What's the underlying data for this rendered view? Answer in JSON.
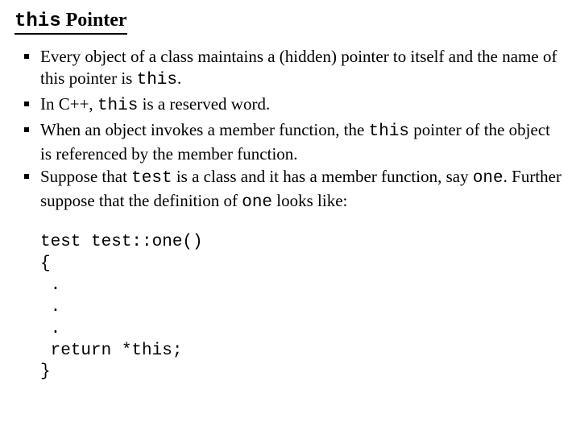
{
  "title": {
    "code": "this",
    "rest": " Pointer"
  },
  "bullets": [
    {
      "parts": [
        {
          "t": "Every object of a class maintains a (hidden) pointer to itself and the name of this pointer is "
        },
        {
          "t": "this",
          "mono": true
        },
        {
          "t": "."
        }
      ]
    },
    {
      "parts": [
        {
          "t": "In C++, "
        },
        {
          "t": "this",
          "mono": true
        },
        {
          "t": " is a reserved word."
        }
      ]
    },
    {
      "parts": [
        {
          "t": "When an object invokes a member function, the "
        },
        {
          "t": "this",
          "mono": true
        },
        {
          "t": " pointer of the object is referenced by the member function."
        }
      ]
    },
    {
      "parts": [
        {
          "t": "Suppose that "
        },
        {
          "t": "test",
          "mono": true
        },
        {
          "t": " is a class and it has a member function, say "
        },
        {
          "t": "one",
          "mono": true
        },
        {
          "t": ". Further suppose that the definition of "
        },
        {
          "t": "one",
          "mono": true
        },
        {
          "t": " looks like:"
        }
      ]
    }
  ],
  "code": "test test::one()\n{\n .\n .\n .\n return *this;\n}"
}
